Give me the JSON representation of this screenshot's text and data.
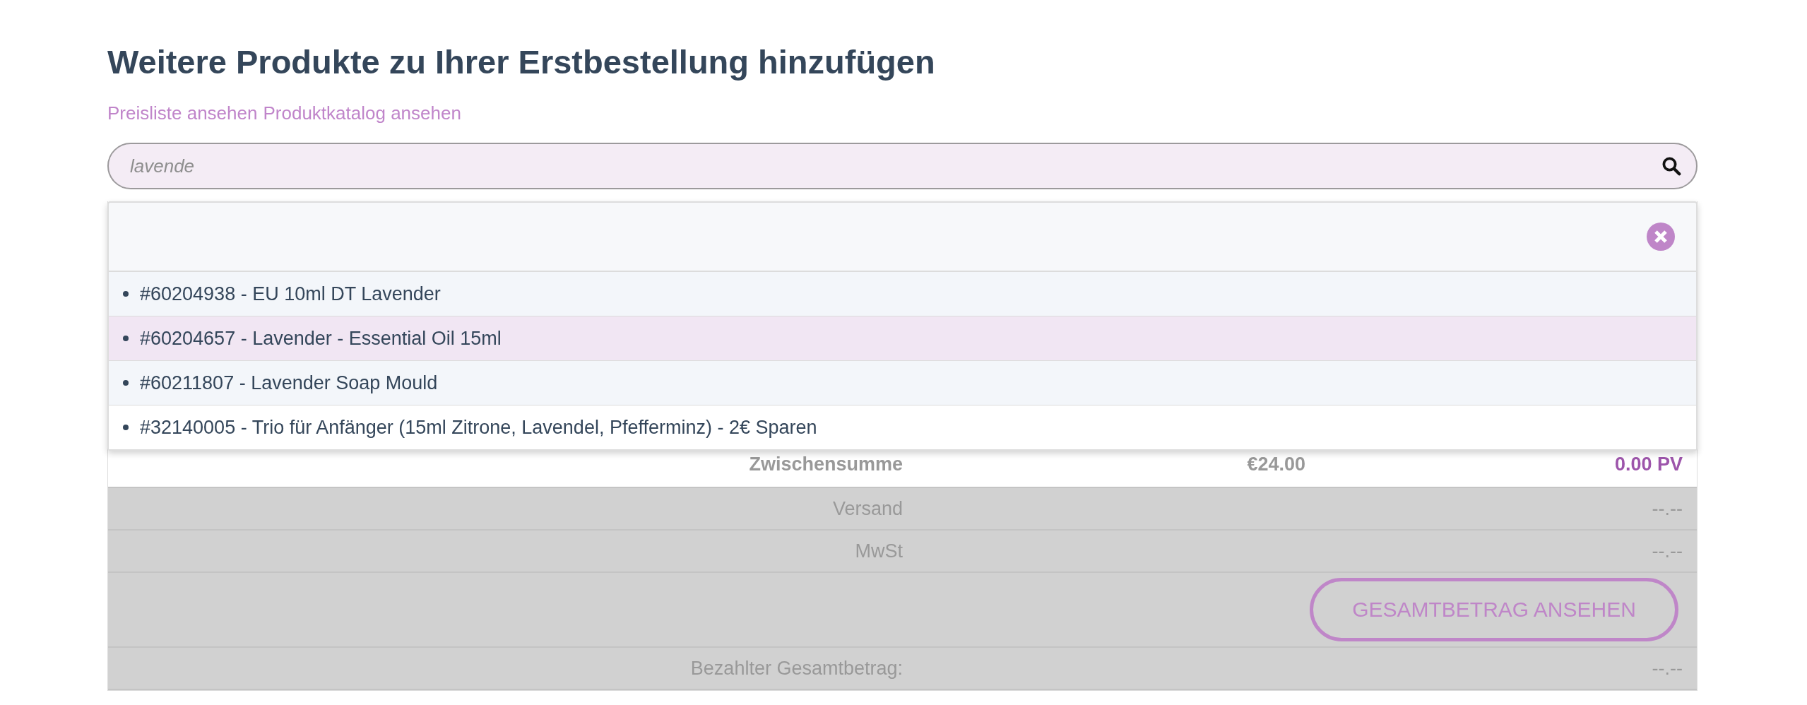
{
  "title": "Weitere Produkte zu Ihrer Erstbestellung hinzufügen",
  "links": [
    "Preisliste ansehen",
    "Produktkatalog ansehen"
  ],
  "search": {
    "value": "lavende"
  },
  "dropdown": {
    "items": [
      {
        "label": "#60204938 - EU 10ml DT Lavender",
        "selected": false
      },
      {
        "label": "#60204657 - Lavender - Essential Oil 15ml",
        "selected": true
      },
      {
        "label": "#60211807 - Lavender Soap Mould",
        "selected": false
      },
      {
        "label": "#32140005 - Trio für Anfänger (15ml Zitrone, Lavendel, Pfefferminz) - 2€ Sparen",
        "selected": false
      }
    ]
  },
  "summary": {
    "rows": [
      {
        "kind": "subtotal",
        "label": "Zwischensumme",
        "price": "€24.00",
        "points": "0.00 PV"
      },
      {
        "kind": "line",
        "label": "Versand",
        "value": "--.--"
      },
      {
        "kind": "line",
        "label": "MwSt",
        "value": "--.--"
      },
      {
        "kind": "action",
        "button": "GESAMTBETRAG ANSEHEN"
      },
      {
        "kind": "line",
        "label": "Bezahlter Gesamtbetrag:",
        "value": "--.--"
      }
    ]
  }
}
